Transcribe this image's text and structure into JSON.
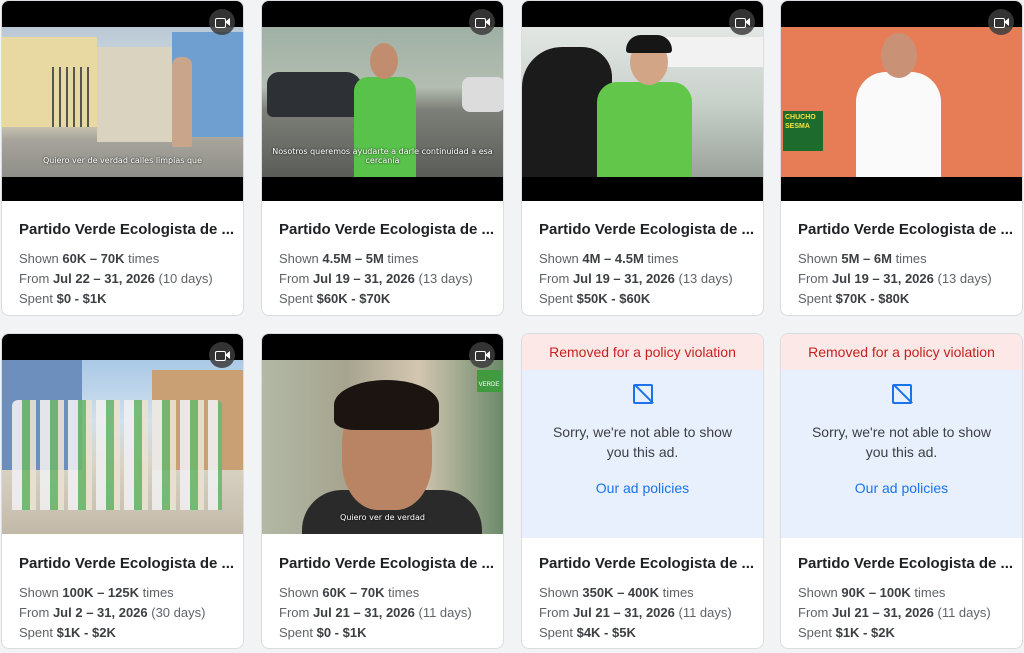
{
  "cards": [
    {
      "title": "Partido Verde Ecologista de ...",
      "shown_prefix": "Shown ",
      "shown": "60K – 70K",
      "shown_suffix": " times",
      "from_prefix": "From ",
      "dates": "Jul 22 – 31, 2026",
      "days": " (10 days)",
      "spent_prefix": "Spent ",
      "spent": "$0 - $1K",
      "subtitle": "Quiero ver de verdad calles limpias que"
    },
    {
      "title": "Partido Verde Ecologista de ...",
      "shown_prefix": "Shown ",
      "shown": "4.5M – 5M",
      "shown_suffix": " times",
      "from_prefix": "From ",
      "dates": "Jul 19 – 31, 2026",
      "days": " (13 days)",
      "spent_prefix": "Spent ",
      "spent": "$60K - $70K",
      "subtitle": "Nosotros queremos ayudarte a darle continuidad a esa cercanía"
    },
    {
      "title": "Partido Verde Ecologista de ...",
      "shown_prefix": "Shown ",
      "shown": "4M – 4.5M",
      "shown_suffix": " times",
      "from_prefix": "From ",
      "dates": "Jul 19 – 31, 2026",
      "days": " (13 days)",
      "spent_prefix": "Spent ",
      "spent": "$50K - $60K",
      "subtitle": ""
    },
    {
      "title": "Partido Verde Ecologista de ...",
      "shown_prefix": "Shown ",
      "shown": "5M – 6M",
      "shown_suffix": " times",
      "from_prefix": "From ",
      "dates": "Jul 19 – 31, 2026",
      "days": " (13 days)",
      "spent_prefix": "Spent ",
      "spent": "$70K - $80K",
      "subtitle": "",
      "logo_text": "CHUCHO SESMA"
    },
    {
      "title": "Partido Verde Ecologista de ...",
      "shown_prefix": "Shown ",
      "shown": "100K – 125K",
      "shown_suffix": " times",
      "from_prefix": "From ",
      "dates": "Jul 2 – 31, 2026",
      "days": " (30 days)",
      "spent_prefix": "Spent ",
      "spent": "$1K - $2K",
      "subtitle": ""
    },
    {
      "title": "Partido Verde Ecologista de ...",
      "shown_prefix": "Shown ",
      "shown": "60K – 70K",
      "shown_suffix": " times",
      "from_prefix": "From ",
      "dates": "Jul 21 – 31, 2026",
      "days": " (11 days)",
      "spent_prefix": "Spent ",
      "spent": "$0 - $1K",
      "subtitle": "Quiero ver de verdad",
      "badge_text": "VERDE"
    },
    {
      "title": "Partido Verde Ecologista de ...",
      "shown_prefix": "Shown ",
      "shown": "350K – 400K",
      "shown_suffix": " times",
      "from_prefix": "From ",
      "dates": "Jul 21 – 31, 2026",
      "days": " (11 days)",
      "spent_prefix": "Spent ",
      "spent": "$4K - $5K"
    },
    {
      "title": "Partido Verde Ecologista de ...",
      "shown_prefix": "Shown ",
      "shown": "90K – 100K",
      "shown_suffix": " times",
      "from_prefix": "From ",
      "dates": "Jul 21 – 31, 2026",
      "days": " (11 days)",
      "spent_prefix": "Spent ",
      "spent": "$1K - $2K"
    }
  ],
  "removed": {
    "banner": "Removed for a policy violation",
    "message": "Sorry, we're not able to show you this ad.",
    "link": "Our ad policies"
  },
  "icons": {
    "video": "video-camera-icon",
    "no_image": "image-unavailable-icon"
  },
  "colors": {
    "removed_text": "#c5221f",
    "removed_bg": "#fce8e6",
    "link": "#1a73e8",
    "panel_bg": "#e8f0fe"
  }
}
